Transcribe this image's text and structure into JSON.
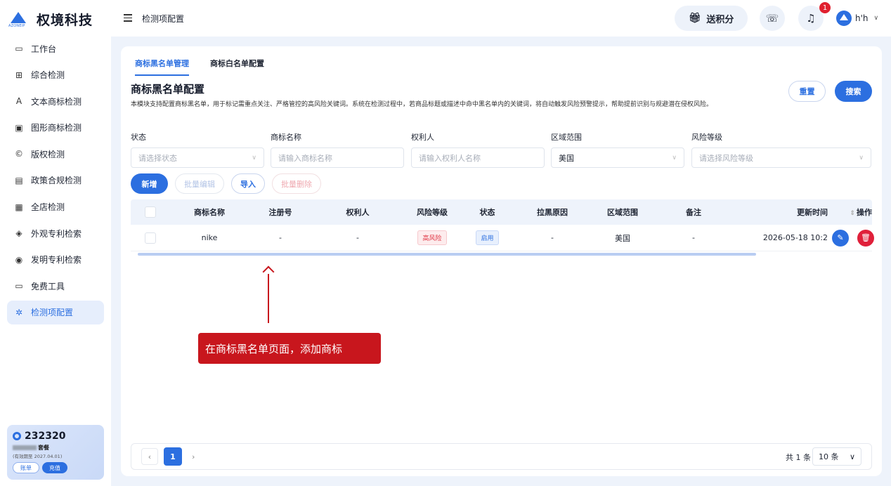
{
  "brand": {
    "name": "权境科技",
    "sub": "AZONEIP"
  },
  "sidebar": {
    "items": [
      {
        "label": "工作台",
        "icon": "laptop-icon"
      },
      {
        "label": "综合检测",
        "icon": "grid-icon"
      },
      {
        "label": "文本商标检测",
        "icon": "text-icon"
      },
      {
        "label": "图形商标检测",
        "icon": "image-icon"
      },
      {
        "label": "版权检测",
        "icon": "copyright-icon"
      },
      {
        "label": "政策合规检测",
        "icon": "policy-icon"
      },
      {
        "label": "全店检测",
        "icon": "store-icon"
      },
      {
        "label": "外观专利检索",
        "icon": "cube-icon"
      },
      {
        "label": "发明专利检索",
        "icon": "pin-icon"
      },
      {
        "label": "免费工具",
        "icon": "toolbox-icon"
      },
      {
        "label": "检测项配置",
        "icon": "settings-icon"
      }
    ],
    "card": {
      "points": "232320",
      "plan": "套餐",
      "expire": "(有效期至 2027.04.01)",
      "bill_label": "账单",
      "recharge_label": "充值"
    }
  },
  "header": {
    "breadcrumb": "检测项配置",
    "gift_label": "送积分",
    "notify_count": "1",
    "user_name": "h'h"
  },
  "tabs": [
    "商标黑名单管理",
    "商标白名单配置"
  ],
  "page": {
    "title": "商标黑名单配置",
    "description": "本模块支持配置商标黑名单，用于标记需重点关注、严格管控的高风险关键词。系统在检测过程中，若商品标题或描述中命中黑名单内的关键词，将自动触发风险预警提示，帮助提前识别与规避潜在侵权风险。",
    "reset_label": "重置",
    "search_label": "搜索"
  },
  "filters": {
    "status": {
      "label": "状态",
      "placeholder": "请选择状态"
    },
    "name": {
      "label": "商标名称",
      "placeholder": "请输入商标名称"
    },
    "owner": {
      "label": "权利人",
      "placeholder": "请输入权利人名称"
    },
    "region": {
      "label": "区域范围",
      "value": "美国"
    },
    "risk": {
      "label": "风险等级",
      "placeholder": "请选择风险等级"
    }
  },
  "actions": {
    "add": "新增",
    "batch_edit": "批量编辑",
    "import": "导入",
    "batch_delete": "批量删除"
  },
  "table": {
    "columns": [
      "商标名称",
      "注册号",
      "权利人",
      "风险等级",
      "状态",
      "拉黑原因",
      "区域范围",
      "备注",
      "更新时间",
      "操作"
    ],
    "rows": [
      {
        "name": "nike",
        "reg_no": "-",
        "owner": "-",
        "risk": "高风险",
        "status": "启用",
        "reason": "-",
        "region": "美国",
        "remark": "-",
        "updated": "2026-05-18 10:2"
      }
    ]
  },
  "pager": {
    "current": "1",
    "total": "共 1 条",
    "size": "10 条"
  },
  "annotation": {
    "text": "在商标黑名单页面，添加商标"
  },
  "colors": {
    "accent": "#2c6fe0",
    "danger": "#e0203a",
    "callout": "#c8161d"
  }
}
